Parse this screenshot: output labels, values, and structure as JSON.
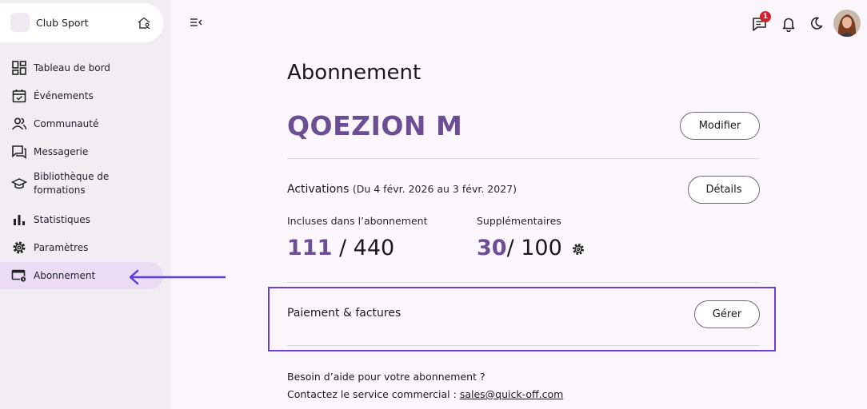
{
  "sidebar": {
    "club_name": "Club Sport",
    "items": [
      {
        "label": "Tableau de bord",
        "icon": "dashboard-icon"
      },
      {
        "label": "Événements",
        "icon": "calendar-icon"
      },
      {
        "label": "Communauté",
        "icon": "users-icon"
      },
      {
        "label": "Messagerie",
        "icon": "chat-icon"
      },
      {
        "label": "Bibliothèque de formations",
        "icon": "graduation-icon"
      },
      {
        "label": "Statistiques",
        "icon": "bar-chart-icon"
      },
      {
        "label": "Paramètres",
        "icon": "gear-icon"
      },
      {
        "label": "Abonnement",
        "icon": "subscription-icon",
        "active": true
      }
    ]
  },
  "topbar": {
    "notification_count": "1"
  },
  "main": {
    "title": "Abonnement",
    "plan_name": "QOEZION M",
    "modify_button": "Modifier",
    "activations": {
      "label": "Activations",
      "period": "(Du 4 févr. 2026 au 3 févr. 2027)",
      "details_button": "Détails",
      "included_label": "Incluses dans l’abonnement",
      "included_used": "111",
      "included_total": "/ 440",
      "extra_label": "Supplémentaires",
      "extra_used": "30",
      "extra_total": "/ 100"
    },
    "payment": {
      "label": "Paiement & factures",
      "manage_button": "Gérer"
    },
    "help": {
      "line1": "Besoin d’aide pour votre abonnement ?",
      "line2_prefix": "Contactez le service commercial : ",
      "email": "sales@quick-off.com"
    }
  },
  "colors": {
    "accent": "#6b4e93",
    "highlight_box": "#6a3fd6",
    "arrow": "#5b3fd0",
    "active_nav": "#ebdcf4",
    "badge": "#d3202a"
  }
}
